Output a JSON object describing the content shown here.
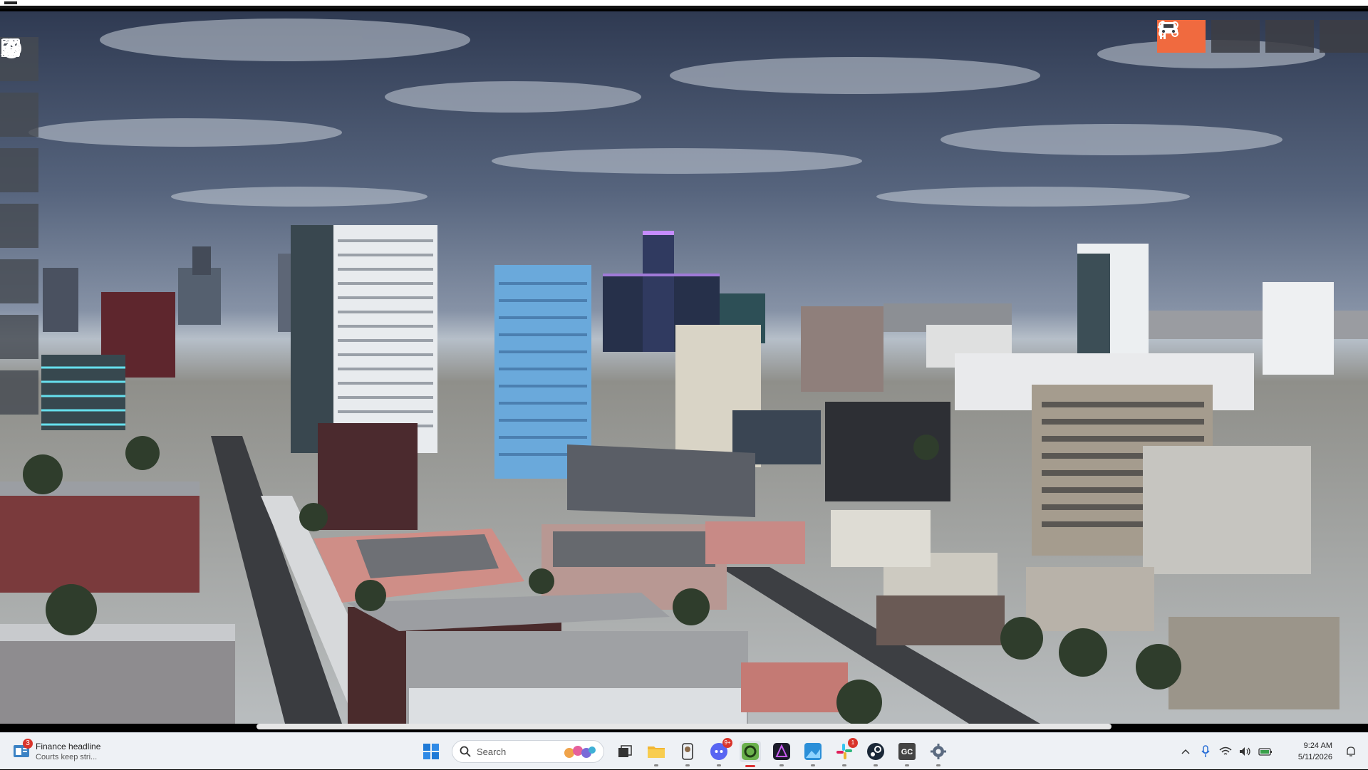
{
  "rail": {
    "items": [
      {
        "icon": "grid-icon"
      },
      {
        "icon": "aperture-icon"
      },
      {
        "icon": "sun-icon"
      },
      {
        "icon": "terrain-brush-icon"
      },
      {
        "icon": "list-icon"
      },
      {
        "icon": "bar-chart-icon"
      },
      {
        "icon": "music-icon"
      }
    ]
  },
  "modes": {
    "active": "orbit-mode",
    "items": [
      "drone-icon",
      "eye-icon",
      "pedestrian-icon",
      "car-icon"
    ],
    "accent": "#f06a3f"
  },
  "taskbar": {
    "widget": {
      "badge": "3",
      "headline": "Finance headline",
      "sub": "Courts keep stri..."
    },
    "search": {
      "placeholder": "Search"
    },
    "apps": [
      {
        "icon": "file-explorer-icon",
        "running": true
      },
      {
        "icon": "phone-link-icon",
        "running": true
      },
      {
        "icon": "discord-icon",
        "badge": "9+",
        "running": true
      },
      {
        "icon": "app-ring-icon",
        "running": true,
        "active": true
      },
      {
        "icon": "affinity-icon",
        "running": true
      },
      {
        "icon": "photos-icon",
        "running": true
      },
      {
        "icon": "slack-icon",
        "badge": "1",
        "running": true
      },
      {
        "icon": "steam-icon",
        "running": true
      },
      {
        "icon": "gc-icon",
        "label": "GC",
        "running": true
      },
      {
        "icon": "settings-icon",
        "running": true
      }
    ],
    "clock": {
      "time": "9:24 AM",
      "date": "5/11/2026"
    }
  }
}
